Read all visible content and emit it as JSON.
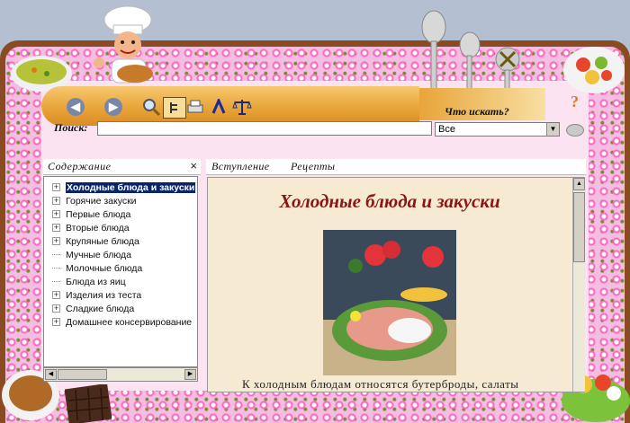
{
  "toolbar": {
    "buttons": [
      "back-icon",
      "forward-icon",
      "search-icon",
      "hide-icon",
      "print-icon",
      "font-icon",
      "scales-icon"
    ]
  },
  "search": {
    "label": "Поиск:",
    "value": "",
    "prompt": "Что искать?",
    "help": "?",
    "scope": "Все"
  },
  "sidebar": {
    "title": "Содержание",
    "close": "×",
    "items": [
      {
        "label": "Холодные блюда и закуски",
        "expandable": true,
        "selected": true
      },
      {
        "label": "Горячие закуски",
        "expandable": true
      },
      {
        "label": "Первые блюда",
        "expandable": true
      },
      {
        "label": "Вторые блюда",
        "expandable": true
      },
      {
        "label": "Крупяные блюда",
        "expandable": true
      },
      {
        "label": "Мучные блюда",
        "expandable": false
      },
      {
        "label": "Молочные блюда",
        "expandable": false
      },
      {
        "label": "Блюда из яиц",
        "expandable": false
      },
      {
        "label": "Изделия из теста",
        "expandable": true
      },
      {
        "label": "Сладкие блюда",
        "expandable": true
      },
      {
        "label": "Домашнее консервирование",
        "expandable": true
      }
    ]
  },
  "tabs": [
    {
      "label": "Вступление"
    },
    {
      "label": "Рецепты"
    }
  ],
  "document": {
    "title": "Холодные блюда и закуски",
    "text": "К холодным блюдам относятся бутерброды, салаты"
  },
  "colors": {
    "title": "#8b1515",
    "selection": "#0a246a",
    "frame": "#8a4a22",
    "floral": "#f5bde2"
  }
}
